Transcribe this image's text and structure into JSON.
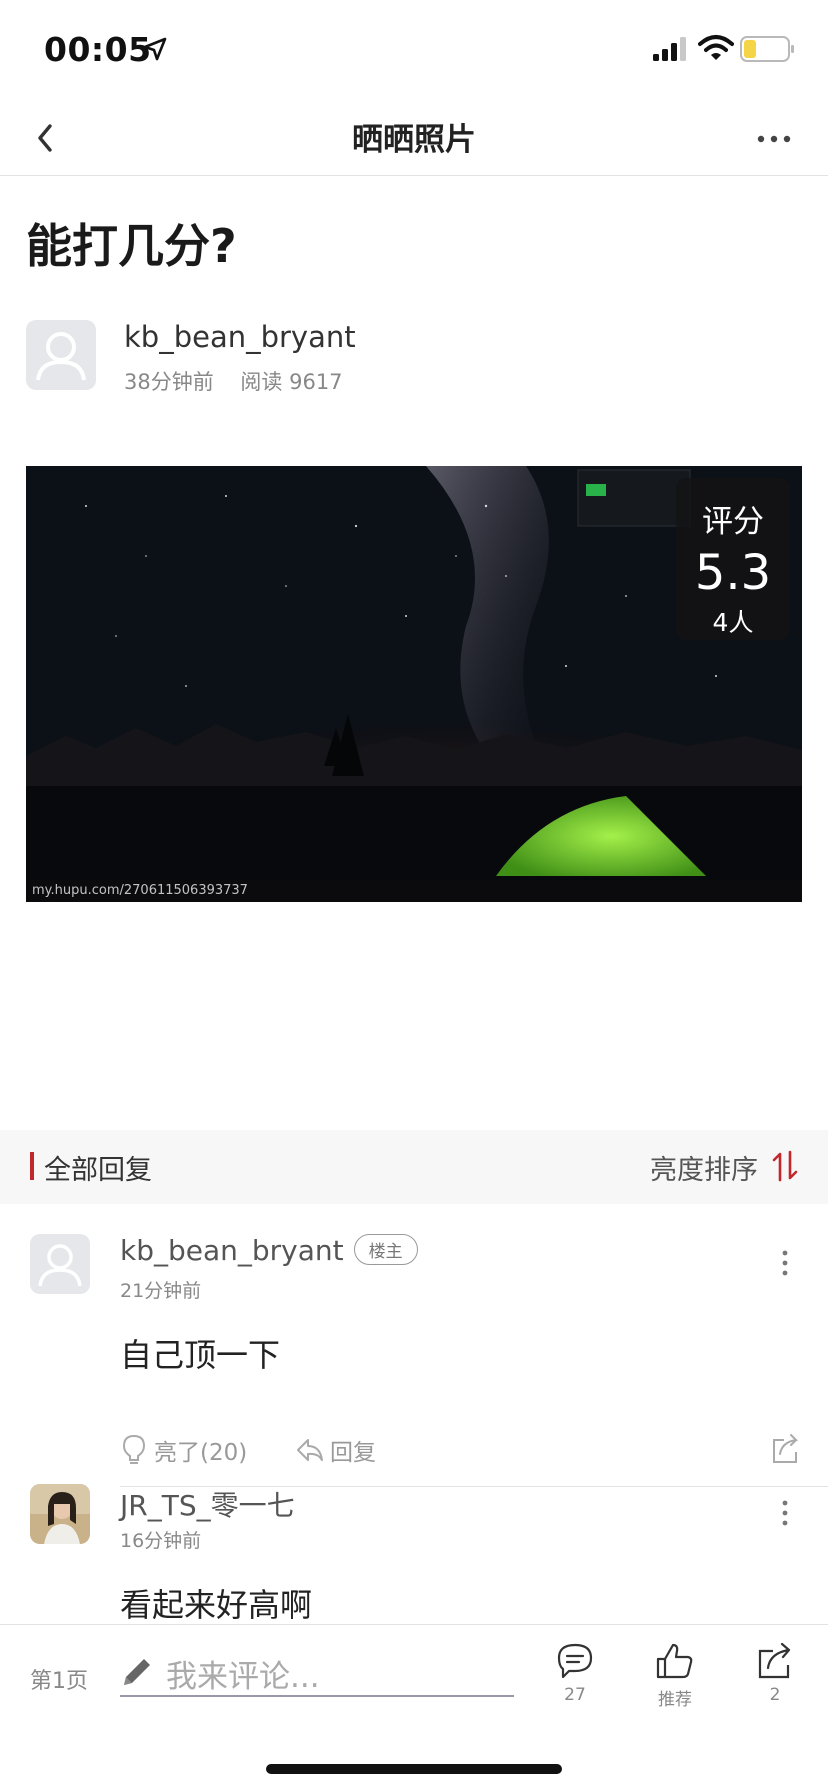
{
  "status_bar": {
    "time": "00:05",
    "icons": [
      "location-arrow-icon",
      "cellular-signal-icon",
      "wifi-icon",
      "battery-low-icon"
    ],
    "battery_color": "#f5d547"
  },
  "nav": {
    "title": "晒晒照片",
    "back_icon": "chevron-left-icon",
    "more_icon": "ellipsis-icon"
  },
  "post": {
    "title": "能打几分?",
    "author": "kb_bean_bryant",
    "time": "38分钟前",
    "reads": "阅读 9617",
    "photo": {
      "watermark": "my.hupu.com/270611506393737",
      "rating_label": "评分",
      "rating_score": "5.3",
      "rating_count": "4人"
    }
  },
  "replies": {
    "title": "全部回复",
    "sort_label": "亮度排序",
    "accent_color": "#c1272d",
    "comments": [
      {
        "author": "kb_bean_bryant",
        "badge": "楼主",
        "time": "21分钟前",
        "text": "自己顶一下",
        "light_label": "亮了(20)",
        "reply_label": "回复"
      },
      {
        "author": "JR_TS_零一七",
        "time": "16分钟前",
        "text": "看起来好高啊"
      }
    ]
  },
  "bottom_bar": {
    "page_label": "第1页",
    "input_placeholder": "我来评论...",
    "comments_count": "27",
    "recommend_label": "推荐",
    "share_count": "2"
  }
}
